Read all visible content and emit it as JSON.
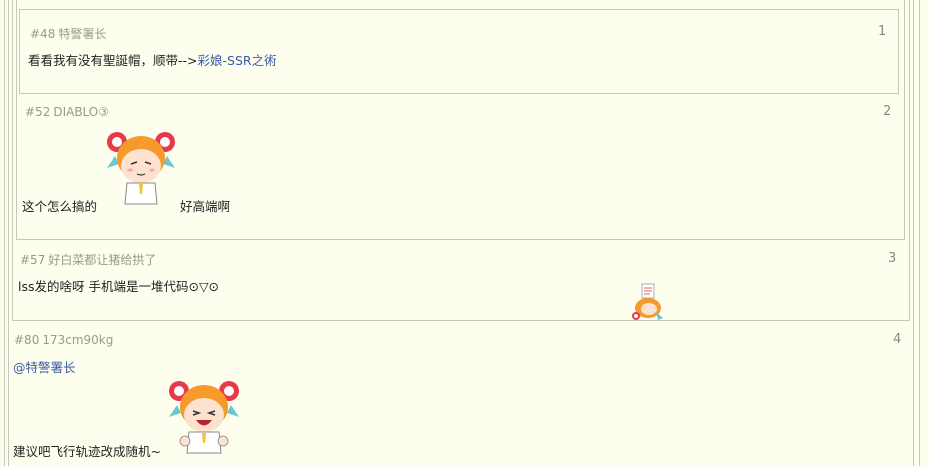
{
  "posts": [
    {
      "num": "#48",
      "author": "特警署长",
      "floor": "1",
      "text": "看看我有没有聖誕帽，顺带-->",
      "link": "彩娘-SSR之術"
    },
    {
      "num": "#52",
      "author": "DIABLO③",
      "floor": "2",
      "text_before": "这个怎么搞的",
      "text_after": "好高端啊",
      "sticker": "ac-girl-smug-sticker"
    },
    {
      "num": "#57",
      "author": "好白菜都让猪给拱了",
      "floor": "3",
      "text": "lss发的啥呀 手机端是一堆代码⊙▽⊙",
      "sticker": "ac-girl-small-sticker"
    },
    {
      "num": "#80",
      "author": "173cm90kg",
      "floor": "4",
      "mention": "@特警署长",
      "text": "建议吧飞行轨迹改成随机~",
      "sticker": "ac-girl-laugh-sticker"
    }
  ],
  "colors": {
    "background": "#fefeee",
    "border": "#c8c8b8",
    "link": "#3a5aa6",
    "meta": "#9a9a8a"
  }
}
